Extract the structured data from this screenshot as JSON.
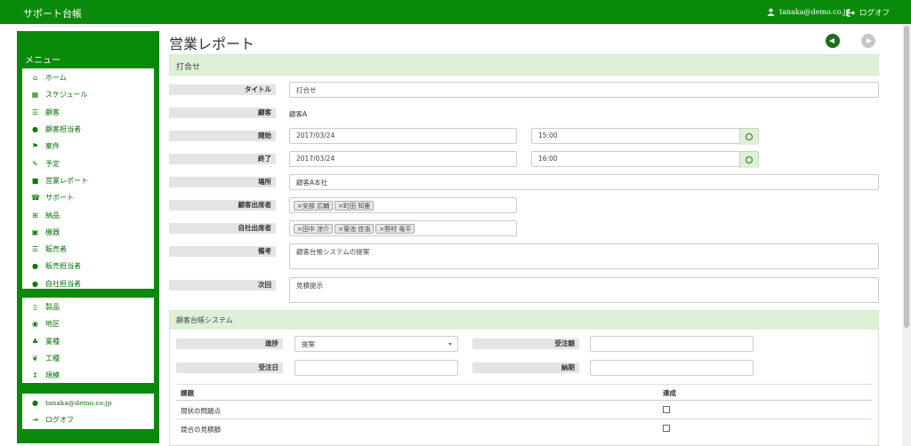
{
  "header": {
    "brand": "サポート台帳",
    "user_email": "tanaka@demo.co.jp",
    "logout_label": "ログオフ"
  },
  "sidebar": {
    "title": "メニュー",
    "group1": [
      {
        "label": "ホーム",
        "icon": "home-icon"
      },
      {
        "label": "スケジュール",
        "icon": "calendar-icon"
      },
      {
        "label": "顧客",
        "icon": "list-icon"
      },
      {
        "label": "顧客担当者",
        "icon": "user-icon"
      },
      {
        "label": "案件",
        "icon": "flag-icon"
      },
      {
        "label": "予定",
        "icon": "pin-icon"
      },
      {
        "label": "営業レポート",
        "icon": "briefcase-icon"
      },
      {
        "label": "サポート",
        "icon": "phone-icon"
      },
      {
        "label": "納品",
        "icon": "grid-icon"
      },
      {
        "label": "機器",
        "icon": "printer-icon"
      },
      {
        "label": "販売者",
        "icon": "list-icon"
      },
      {
        "label": "販売担当者",
        "icon": "user-icon"
      },
      {
        "label": "自社担当者",
        "icon": "user-icon"
      }
    ],
    "group2": [
      {
        "label": "製品",
        "icon": "mobile-icon"
      },
      {
        "label": "地区",
        "icon": "map-marker-icon"
      },
      {
        "label": "業種",
        "icon": "tree-icon"
      },
      {
        "label": "工種",
        "icon": "leaf-icon"
      },
      {
        "label": "規模",
        "icon": "resize-vertical-icon"
      }
    ],
    "group3": [
      {
        "label": "tanaka@demo.co.jp",
        "icon": "user-icon"
      },
      {
        "label": "ログオフ",
        "icon": "logout-icon"
      }
    ]
  },
  "page": {
    "title": "営業レポート",
    "section_title": "打合せ"
  },
  "form": {
    "title_label": "タイトル",
    "title_value": "打合せ",
    "customer_label": "顧客",
    "customer_value": "顧客A",
    "start_label": "開始",
    "start_date": "2017/03/24",
    "start_time": "15:00",
    "end_label": "終了",
    "end_date": "2017/03/24",
    "end_time": "16:00",
    "place_label": "場所",
    "place_value": "顧客A本社",
    "cust_attendees_label": "顧客出席者",
    "cust_attendees": [
      "安部 広輔",
      "町田 知憲"
    ],
    "own_attendees_label": "自社出席者",
    "own_attendees": [
      "田中 涼介",
      "菊池 佳浩",
      "野村 竜平"
    ],
    "remarks_label": "備考",
    "remarks_value": "顧客台帳システムの提案",
    "next_label": "次回",
    "next_value": "見積提示"
  },
  "project": {
    "title": "顧客台帳システム",
    "progress_label": "進捗",
    "progress_value": "提案",
    "order_amount_label": "受注額",
    "order_amount_value": "",
    "order_date_label": "受注日",
    "order_date_value": "",
    "delivery_label": "納期",
    "delivery_value": "",
    "col_issue": "課題",
    "col_done": "達成",
    "rows": [
      {
        "issue": "現状の問題点"
      },
      {
        "issue": "競合の見積額"
      }
    ]
  },
  "colors": {
    "brand_green": "#0a8a0a",
    "section_green": "#dff0d8"
  },
  "tag_remove": "×"
}
